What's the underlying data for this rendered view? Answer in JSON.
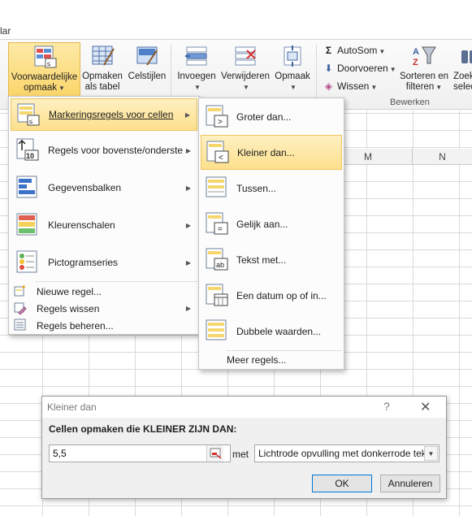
{
  "top_partial_text": "lar",
  "ribbon": {
    "buttons": [
      {
        "label1": "Voorwaardelijke",
        "label2": "opmaak"
      },
      {
        "label1": "Opmaken",
        "label2": "als tabel"
      },
      {
        "label1": "Celstijlen",
        "label2": ""
      },
      {
        "label1": "Invoegen",
        "label2": ""
      },
      {
        "label1": "Verwijderen",
        "label2": ""
      },
      {
        "label1": "Opmaak",
        "label2": ""
      }
    ],
    "edit_small": [
      {
        "icon": "Σ",
        "label": "AutoSom"
      },
      {
        "icon": "⬇",
        "label": "Doorvoeren"
      },
      {
        "icon": "◈",
        "label": "Wissen"
      }
    ],
    "sort": {
      "label1": "Sorteren en",
      "label2": "filteren"
    },
    "find": {
      "label1": "Zoek",
      "label2": "selec"
    },
    "group_label": "Bewerken"
  },
  "grid": {
    "columns": [
      "M",
      "N"
    ]
  },
  "menu": {
    "items": [
      {
        "label": "Markeringsregels voor cellen"
      },
      {
        "label": "Regels voor bovenste/onderste"
      },
      {
        "label": "Gegevensbalken"
      },
      {
        "label": "Kleurenschalen"
      },
      {
        "label": "Pictogramseries"
      }
    ],
    "small_items": [
      {
        "label": "Nieuwe regel..."
      },
      {
        "label": "Regels wissen"
      },
      {
        "label": "Regels beheren..."
      }
    ]
  },
  "submenu": {
    "items": [
      {
        "label": "Groter dan..."
      },
      {
        "label": "Kleiner dan..."
      },
      {
        "label": "Tussen..."
      },
      {
        "label": "Gelijk aan..."
      },
      {
        "label": "Tekst met..."
      },
      {
        "label": "Een datum op of in..."
      },
      {
        "label": "Dubbele waarden..."
      }
    ],
    "more": "Meer regels..."
  },
  "dialog": {
    "title": "Kleiner dan",
    "help": "?",
    "close": "✕",
    "prompt": "Cellen opmaken die KLEINER ZIJN DAN:",
    "value": "5,5",
    "met": "met",
    "format": "Lichtrode opvulling met donkerrode tekst",
    "ok": "OK",
    "cancel": "Annuleren"
  },
  "colors": {
    "highlight": "#fde08d",
    "accent": "#0078d7"
  }
}
